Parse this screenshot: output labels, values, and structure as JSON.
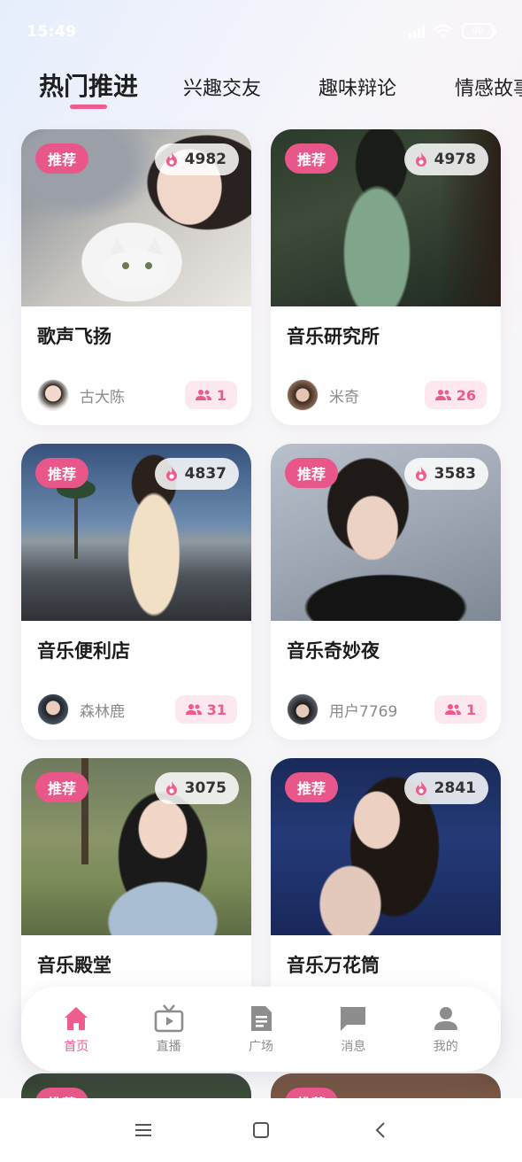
{
  "status_bar": {
    "time": "15:49",
    "battery": "80"
  },
  "tabs": [
    {
      "label": "热门推进"
    },
    {
      "label": "兴趣交友"
    },
    {
      "label": "趣味辩论"
    },
    {
      "label": "情感故事"
    }
  ],
  "cards": [
    {
      "badge": "推荐",
      "heat": "4982",
      "title": "歌声飞扬",
      "host": "古大陈",
      "members": "1"
    },
    {
      "badge": "推荐",
      "heat": "4978",
      "title": "音乐研究所",
      "host": "米奇",
      "members": "26"
    },
    {
      "badge": "推荐",
      "heat": "4837",
      "title": "音乐便利店",
      "host": "森林鹿",
      "members": "31"
    },
    {
      "badge": "推荐",
      "heat": "3583",
      "title": "音乐奇妙夜",
      "host": "用户7769",
      "members": "1"
    },
    {
      "badge": "推荐",
      "heat": "3075",
      "title": "音乐殿堂"
    },
    {
      "badge": "推荐",
      "heat": "2841",
      "title": "音乐万花筒"
    }
  ],
  "peek_cards": [
    {
      "badge": "推荐"
    },
    {
      "badge": "推荐"
    }
  ],
  "bottom_nav": [
    {
      "label": "首页",
      "icon": "home-icon",
      "active": true
    },
    {
      "label": "直播",
      "icon": "tv-icon",
      "active": false
    },
    {
      "label": "广场",
      "icon": "document-icon",
      "active": false
    },
    {
      "label": "消息",
      "icon": "message-icon",
      "active": false
    },
    {
      "label": "我的",
      "icon": "person-icon",
      "active": false
    }
  ],
  "colors": {
    "accent": "#ef5d8e",
    "badge": "#e9578a",
    "members_bg": "#fde8ef"
  }
}
